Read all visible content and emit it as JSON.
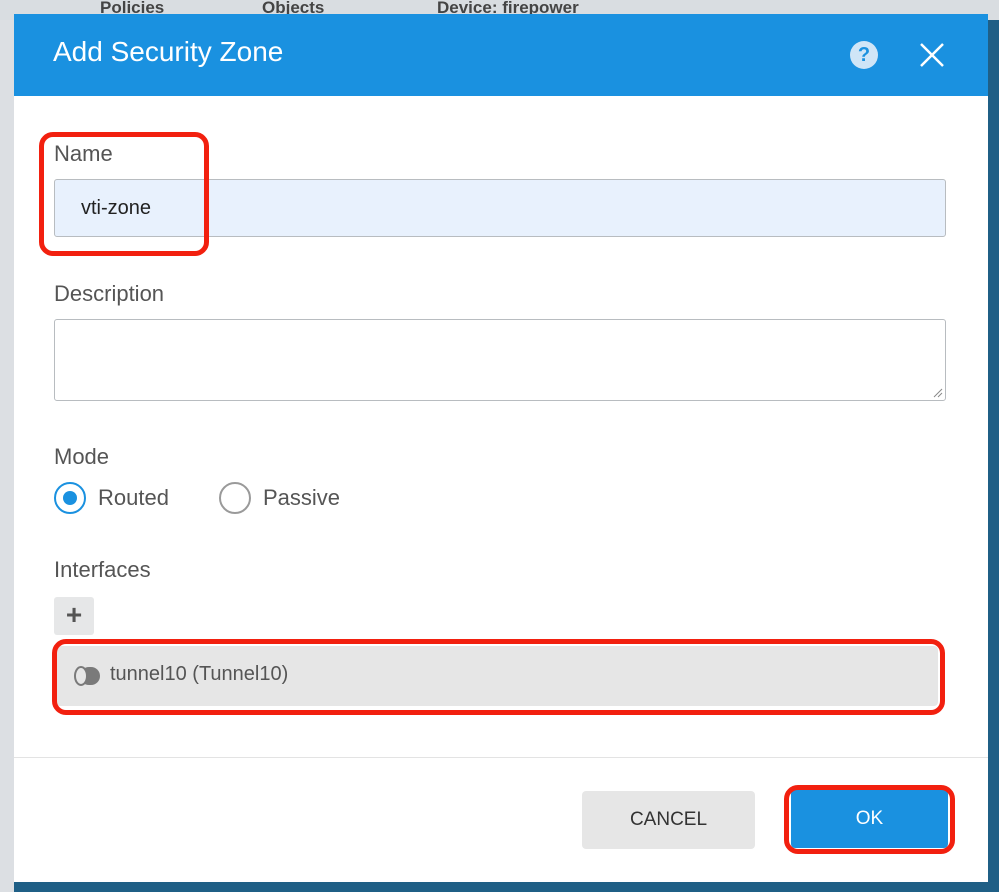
{
  "background": {
    "items": [
      "Policies",
      "Objects",
      "Device: firepower"
    ]
  },
  "dialog": {
    "title": "Add Security Zone",
    "help_icon": "?",
    "close_icon": "close-icon"
  },
  "form": {
    "name_label": "Name",
    "name_value": "vti-zone",
    "description_label": "Description",
    "description_value": "",
    "mode_label": "Mode",
    "mode_options": [
      {
        "label": "Routed",
        "selected": true
      },
      {
        "label": "Passive",
        "selected": false
      }
    ],
    "interfaces_label": "Interfaces",
    "add_interface_symbol": "+",
    "interfaces": [
      {
        "label": "tunnel10 (Tunnel10)",
        "icon": "tunnel-icon"
      }
    ]
  },
  "footer": {
    "cancel_label": "CANCEL",
    "ok_label": "OK"
  },
  "colors": {
    "header": "#1a91e0",
    "highlight": "#f2200f",
    "primary_button": "#1a91e0"
  }
}
